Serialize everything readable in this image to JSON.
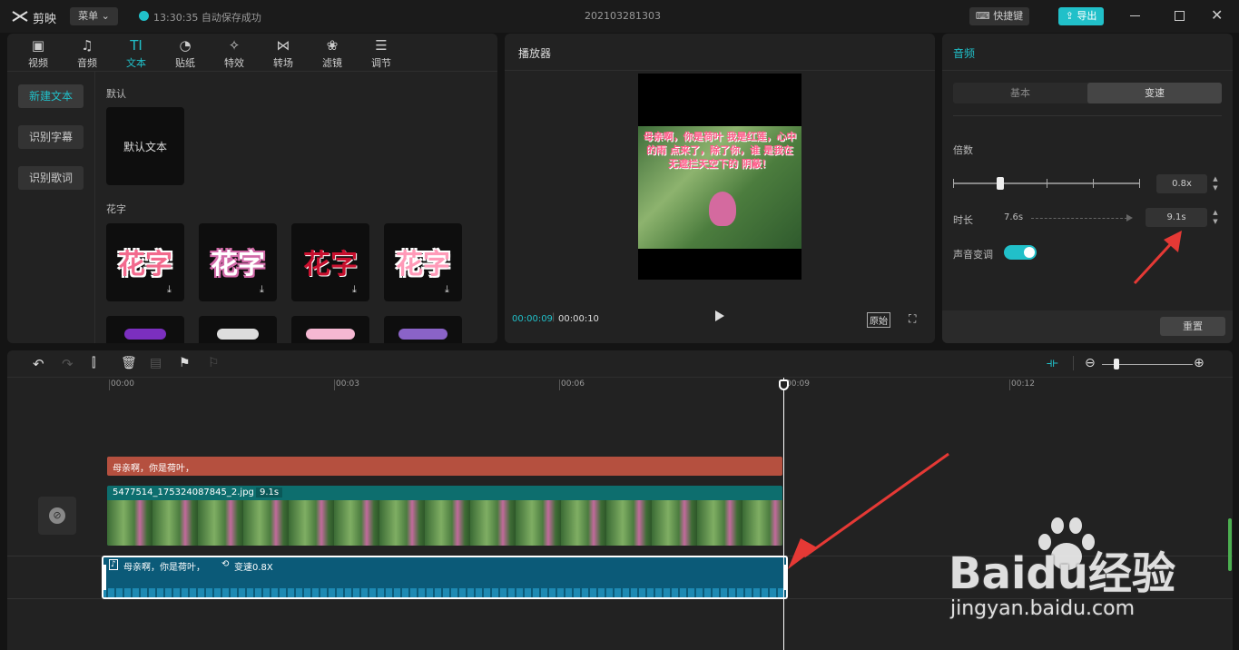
{
  "app": {
    "name": "剪映",
    "menu_label": "菜单",
    "autosave_text": "13:30:35 自动保存成功",
    "project_title": "202103281303",
    "shortcut_label": "快捷键",
    "export_label": "导出"
  },
  "toolbar_tabs": [
    "视频",
    "音频",
    "文本",
    "贴纸",
    "特效",
    "转场",
    "滤镜",
    "调节"
  ],
  "text_panel": {
    "side_buttons": [
      "新建文本",
      "识别字幕",
      "识别歌词"
    ],
    "section_default": "默认",
    "default_card": "默认文本",
    "section_fancy": "花字",
    "fancy_cards": [
      "花字",
      "花字",
      "花字",
      "花字"
    ]
  },
  "player": {
    "title": "播放器",
    "current_time": "00:00:09",
    "total_time": "00:00:10",
    "original_label": "原始",
    "overlay_text": "母亲啊，你是荷叶 我是红莲，心中的雨 点来了，除了你，谁 是我在无遮拦天空下的 阴蔽！"
  },
  "audio_panel": {
    "title": "音频",
    "tabs": [
      "基本",
      "变速"
    ],
    "speed_label": "倍数",
    "speed_value": "0.8x",
    "speed_level": 0.25,
    "duration_label": "时长",
    "duration_original": "7.6s",
    "duration_new": "9.1s",
    "pitch_label": "声音变调",
    "reset_label": "重置"
  },
  "timeline": {
    "ruler_labels": [
      "00:00",
      "00:03",
      "00:06",
      "00:09",
      "00:12"
    ],
    "text_clip": "母亲啊，你是荷叶，",
    "video_clip_name": "5477514_175324087845_2.jpg",
    "video_clip_duration": "9.1s",
    "audio_clip_name": "母亲啊，你是荷叶，",
    "audio_clip_speed": "变速0.8X"
  },
  "watermark": {
    "brand": "Baidu经验",
    "url": "jingyan.baidu.com"
  },
  "colors": {
    "accent": "#21c0c9",
    "text_clip": "#b5503f",
    "video_clip": "#0d6e6e",
    "audio_clip": "#0b5a78",
    "arrow": "#e53935"
  }
}
